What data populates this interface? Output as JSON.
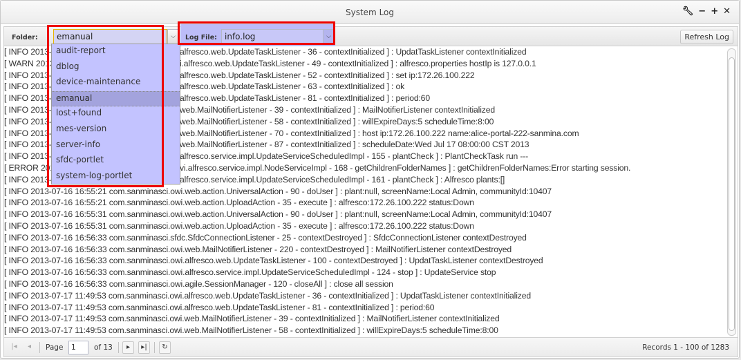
{
  "window": {
    "title": "System Log",
    "tools": [
      "wrench-icon",
      "minimize-icon",
      "maximize-icon",
      "close-icon"
    ]
  },
  "toolbar": {
    "folder_label": "Folder:",
    "folder_value": "emanual",
    "logfile_label": "Log File:",
    "logfile_value": "info.log",
    "refresh_label": "Refresh Log"
  },
  "folder_options": [
    "audit-report",
    "dblog",
    "device-maintenance",
    "emanual",
    "lost+found",
    "mes-version",
    "server-info",
    "sfdc-portlet",
    "system-log-portlet"
  ],
  "folder_selected": "emanual",
  "log_partial": [
    {
      "prefix": "[ INFO 2013-0",
      "suffix": "alfresco.web.UpdateTaskListener - 36 - contextInitialized ] : UpdatTaskListener contextInitialized"
    },
    {
      "prefix": "[ WARN 2013-",
      "suffix": "i.alfresco.web.UpdateTaskListener - 49 - contextInitialized ] : alfresco.properties hostIp is 127.0.0.1"
    },
    {
      "prefix": "[ INFO 2013-0",
      "suffix": "alfresco.web.UpdateTaskListener - 52 - contextInitialized ] : set ip:172.26.100.222"
    },
    {
      "prefix": "[ INFO 2013-0",
      "suffix": "alfresco.web.UpdateTaskListener - 63 - contextInitialized ] : ok"
    },
    {
      "prefix": "[ INFO 2013-0",
      "suffix": "alfresco.web.UpdateTaskListener - 81 - contextInitialized ] : period:60"
    },
    {
      "prefix": "[ INFO 2013-0",
      "suffix": "web.MailNotifierListener - 39 - contextInitialized ] : MailNotifierListener contextInitialized"
    },
    {
      "prefix": "[ INFO 2013-0",
      "suffix": "web.MailNotifierListener - 58 - contextInitialized ] : willExpireDays:5 scheduleTime:8:00"
    },
    {
      "prefix": "[ INFO 2013-0",
      "suffix": "web.MailNotifierListener - 70 - contextInitialized ] : host ip:172.26.100.222 name:alice-portal-222-sanmina.com"
    },
    {
      "prefix": "[ INFO 2013-0",
      "suffix": "web.MailNotifierListener - 87 - contextInitialized ] : scheduleDate:Wed Jul 17 08:00:00 CST 2013"
    },
    {
      "prefix": "[ INFO 2013-0",
      "suffix": "alfresco.service.impl.UpdateServiceScheduledImpl - 155 - plantCheck ] : PlantCheckTask run ---"
    },
    {
      "prefix": "[ ERROR 2013",
      "suffix": "vi.alfresco.service.impl.NodeServiceImpl - 168 - getChildrenFolderNames ] : getChildrenFolderNames:Error starting session."
    },
    {
      "prefix": "[ INFO 2013-0",
      "suffix": "alfresco.service.impl.UpdateServiceScheduledImpl - 161 - plantCheck ] : Alfresco plants:[]"
    }
  ],
  "log_lines": [
    "[ INFO 2013-07-16 16:55:21 com.sanminasci.owi.web.action.UniversalAction - 90 - doUser ] : plant:null, screenName:Local Admin, communityId:10407",
    "[ INFO 2013-07-16 16:55:21 com.sanminasci.owi.web.action.UploadAction - 35 - execute ] : alfresco:172.26.100.222 status:Down",
    "[ INFO 2013-07-16 16:55:31 com.sanminasci.owi.web.action.UniversalAction - 90 - doUser ] : plant:null, screenName:Local Admin, communityId:10407",
    "[ INFO 2013-07-16 16:55:31 com.sanminasci.owi.web.action.UploadAction - 35 - execute ] : alfresco:172.26.100.222 status:Down",
    "[ INFO 2013-07-16 16:56:33 com.sanminasci.sfdc.SfdcConnectionListener - 25 - contextDestroyed ] : SfdcConnectionListener contextDestroyed",
    "[ INFO 2013-07-16 16:56:33 com.sanminasci.owi.web.MailNotifierListener - 220 - contextDestroyed ] : MailNotifierListener contextDestroyed",
    "[ INFO 2013-07-16 16:56:33 com.sanminasci.owi.alfresco.web.UpdateTaskListener - 100 - contextDestroyed ] : UpdatTaskListener contextDestroyed",
    "[ INFO 2013-07-16 16:56:33 com.sanminasci.owi.alfresco.service.impl.UpdateServiceScheduledImpl - 124 - stop ] : UpdateService stop",
    "[ INFO 2013-07-16 16:56:33 com.sanminasci.owi.agile.SessionManager - 120 - closeAll ] : close all session",
    "[ INFO 2013-07-17 11:49:53 com.sanminasci.owi.alfresco.web.UpdateTaskListener - 36 - contextInitialized ] : UpdatTaskListener contextInitialized",
    "[ INFO 2013-07-17 11:49:53 com.sanminasci.owi.alfresco.web.UpdateTaskListener - 81 - contextInitialized ] : period:60",
    "[ INFO 2013-07-17 11:49:53 com.sanminasci.owi.web.MailNotifierListener - 39 - contextInitialized ] : MailNotifierListener contextInitialized",
    "[ INFO 2013-07-17 11:49:53 com.sanminasci.owi.web.MailNotifierListener - 58 - contextInitialized ] : willExpireDays:5 scheduleTime:8:00"
  ],
  "pager": {
    "page_label": "Page",
    "page_value": "1",
    "of_label": "of 13",
    "records": "Records 1 - 100 of 1283"
  },
  "colors": {
    "highlight": "#ee0000",
    "dropdown_bg": "#c3c3ff",
    "dropdown_selected": "#a3a3dd"
  }
}
